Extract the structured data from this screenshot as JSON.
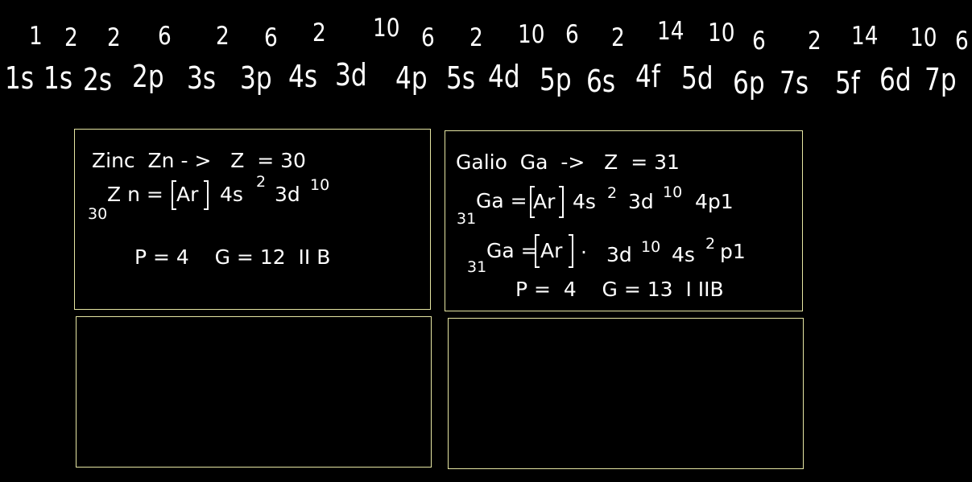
{
  "orbital_sequence": {
    "subshells": [
      "1s",
      "1s",
      "2s",
      "2p",
      "3s",
      "3p",
      "4s",
      "3d",
      "4p",
      "5s",
      "4d",
      "5p",
      "6s",
      "4f",
      "5d",
      "6p",
      "7s",
      "5f",
      "6d",
      "7p"
    ],
    "capacities": [
      "1",
      "2",
      "2",
      "6",
      "2",
      "6",
      "2",
      "10",
      "6",
      "2",
      "10",
      "6",
      "2",
      "14",
      "10",
      "6",
      "2",
      "14",
      "10",
      "6"
    ]
  },
  "zinc_panel": {
    "title": "Zinc  Zn - >   Z  = 30",
    "config_symbol": "Z n =",
    "atomic_number": "30",
    "core": "Ar",
    "config_4s": "4s",
    "config_4s_exp": "2",
    "config_3d": "3d",
    "config_3d_exp": "10",
    "period_group": "P = 4    G = 12  II B"
  },
  "galio_panel": {
    "title": "Galio  Ga  ->   Z  = 31",
    "line1_atomic_number": "31",
    "line1_symbol": "Ga =",
    "line1_core": "Ar",
    "line1_4s": "4s",
    "line1_4s_exp": "2",
    "line1_3d": "3d",
    "line1_3d_exp": "10",
    "line1_4p": "4p1",
    "line2_atomic_number": "31",
    "line2_symbol": "Ga =",
    "line2_core": "Ar",
    "line2_dot": "·",
    "line2_3d": "3d",
    "line2_3d_exp": "10",
    "line2_4s": "4s",
    "line2_4s_exp": "2",
    "line2_p": "p1",
    "period_group": "P =  4    G = 13  I IIB"
  },
  "colors": {
    "background": "#000000",
    "text": "#ffffff",
    "panel_border": "#e6e6a3"
  }
}
